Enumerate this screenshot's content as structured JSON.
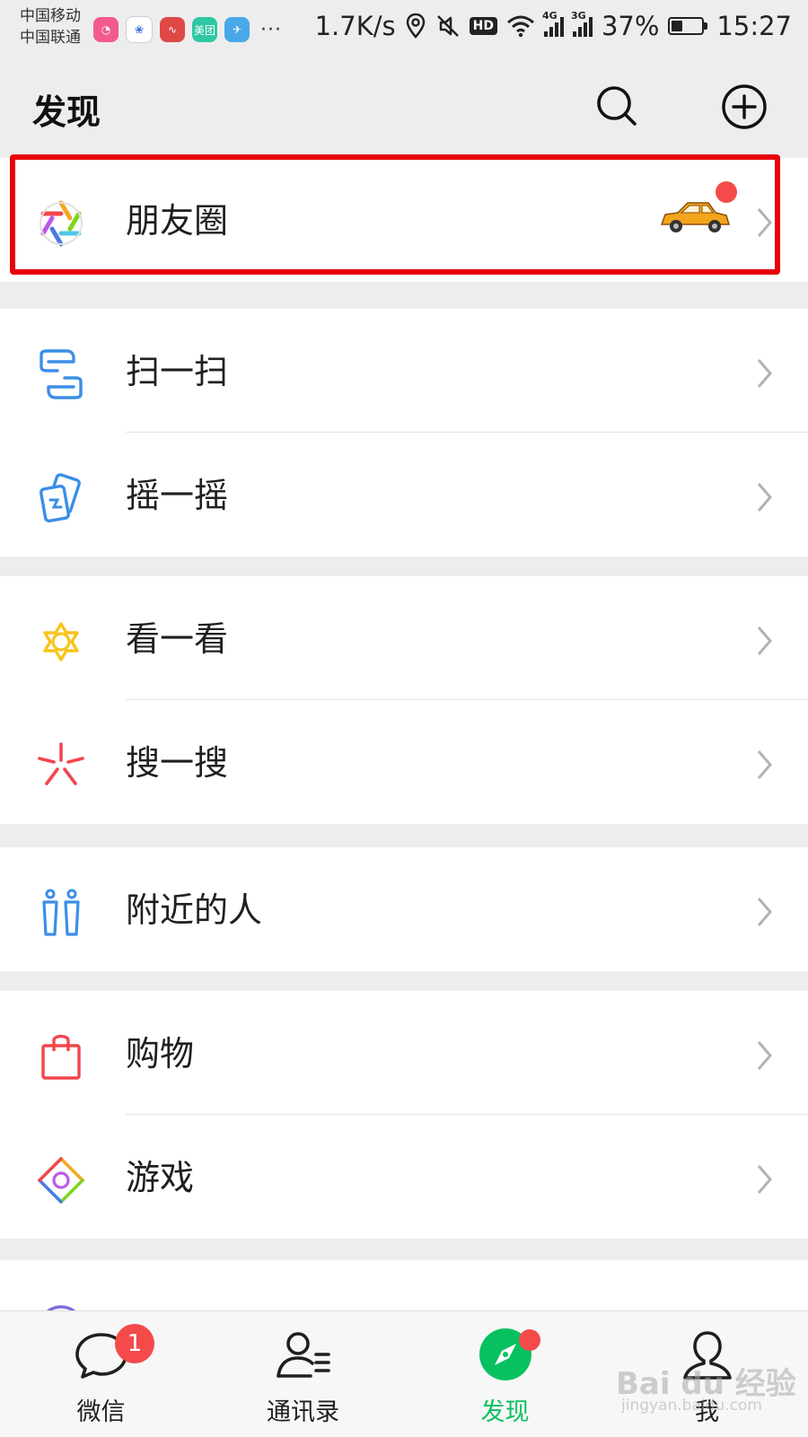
{
  "status_bar": {
    "carrier_1": "中国移动",
    "carrier_2": "中国联通",
    "apps": [
      {
        "name": "pink-app-icon",
        "label": "",
        "color": "#f25b8c"
      },
      {
        "name": "baidu-app-icon",
        "label": "",
        "color": "#3b6fe0"
      },
      {
        "name": "red-app-icon",
        "label": "",
        "color": "#e04848"
      },
      {
        "name": "meituan-app-icon",
        "label": "美团",
        "color": "#2fc7a4"
      },
      {
        "name": "plane-app-icon",
        "label": "",
        "color": "#49a8e8"
      }
    ],
    "more": "···",
    "speed": "1.7K/s",
    "hd": "HD",
    "net_1": "4G",
    "net_2": "3G",
    "battery": "37%",
    "battery_level": 0.37,
    "time": "15:27"
  },
  "header": {
    "title": "发现",
    "search_icon": "search-icon",
    "add_icon": "plus-circle-icon"
  },
  "menu": {
    "moments": {
      "label": "朋友圈",
      "icon": "moments-aperture-icon",
      "extra": "car-sticker"
    },
    "scan": {
      "label": "扫一扫",
      "icon": "scan-icon"
    },
    "shake": {
      "label": "摇一摇",
      "icon": "shake-icon"
    },
    "top_stories": {
      "label": "看一看",
      "icon": "top-stories-icon"
    },
    "search": {
      "label": "搜一搜",
      "icon": "search-spark-icon"
    },
    "nearby": {
      "label": "附近的人",
      "icon": "people-nearby-icon"
    },
    "shopping": {
      "label": "购物",
      "icon": "shopping-bag-icon"
    },
    "games": {
      "label": "游戏",
      "icon": "games-icon"
    },
    "mini_programs": {
      "label": "",
      "icon": "mini-programs-icon"
    }
  },
  "tabs": [
    {
      "label": "微信",
      "icon": "chat-bubble-icon",
      "badge": "1"
    },
    {
      "label": "通讯录",
      "icon": "contacts-icon"
    },
    {
      "label": "发现",
      "icon": "compass-icon",
      "active": true
    },
    {
      "label": "我",
      "icon": "person-icon"
    }
  ],
  "watermark": {
    "main": "Bai du 经验",
    "sub": "jingyan.baidu.com"
  },
  "colors": {
    "accent_green": "#07c160",
    "badge_red": "#f44a4a",
    "highlight_red": "#e8000b",
    "background": "#ededed"
  }
}
